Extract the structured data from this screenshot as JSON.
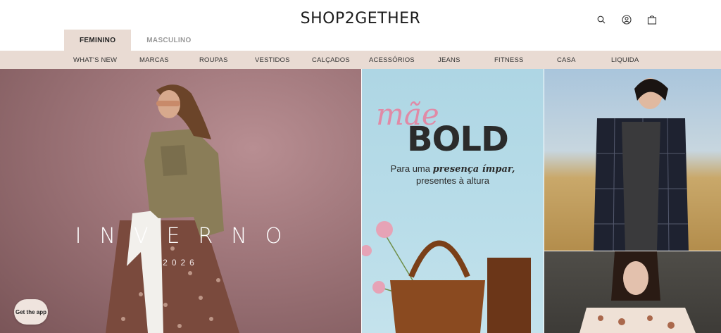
{
  "header": {
    "logo": "SHOP2GETHER",
    "icons": [
      "search-icon",
      "account-icon",
      "bag-icon"
    ]
  },
  "gender_tabs": [
    {
      "label": "FEMININO",
      "active": true
    },
    {
      "label": "MASCULINO",
      "active": false
    }
  ],
  "nav": {
    "items": [
      "WHAT'S NEW",
      "MARCAS",
      "ROUPAS",
      "VESTIDOS",
      "CALÇADOS",
      "ACESSÓRIOS",
      "JEANS",
      "FITNESS",
      "CASA",
      "LIQUIDA"
    ]
  },
  "hero_left": {
    "title": "INVERNO",
    "year": "2026"
  },
  "hero_mid": {
    "script": "mãe",
    "headline": "BOLD",
    "line1_prefix": "Para uma ",
    "line1_emphasis": "presença ímpar,",
    "line2": "presentes à altura"
  },
  "app_button": {
    "label": "Get the app"
  },
  "colors": {
    "nav_bg": "#e9dbd3",
    "accent_pink": "#e08aa6"
  }
}
